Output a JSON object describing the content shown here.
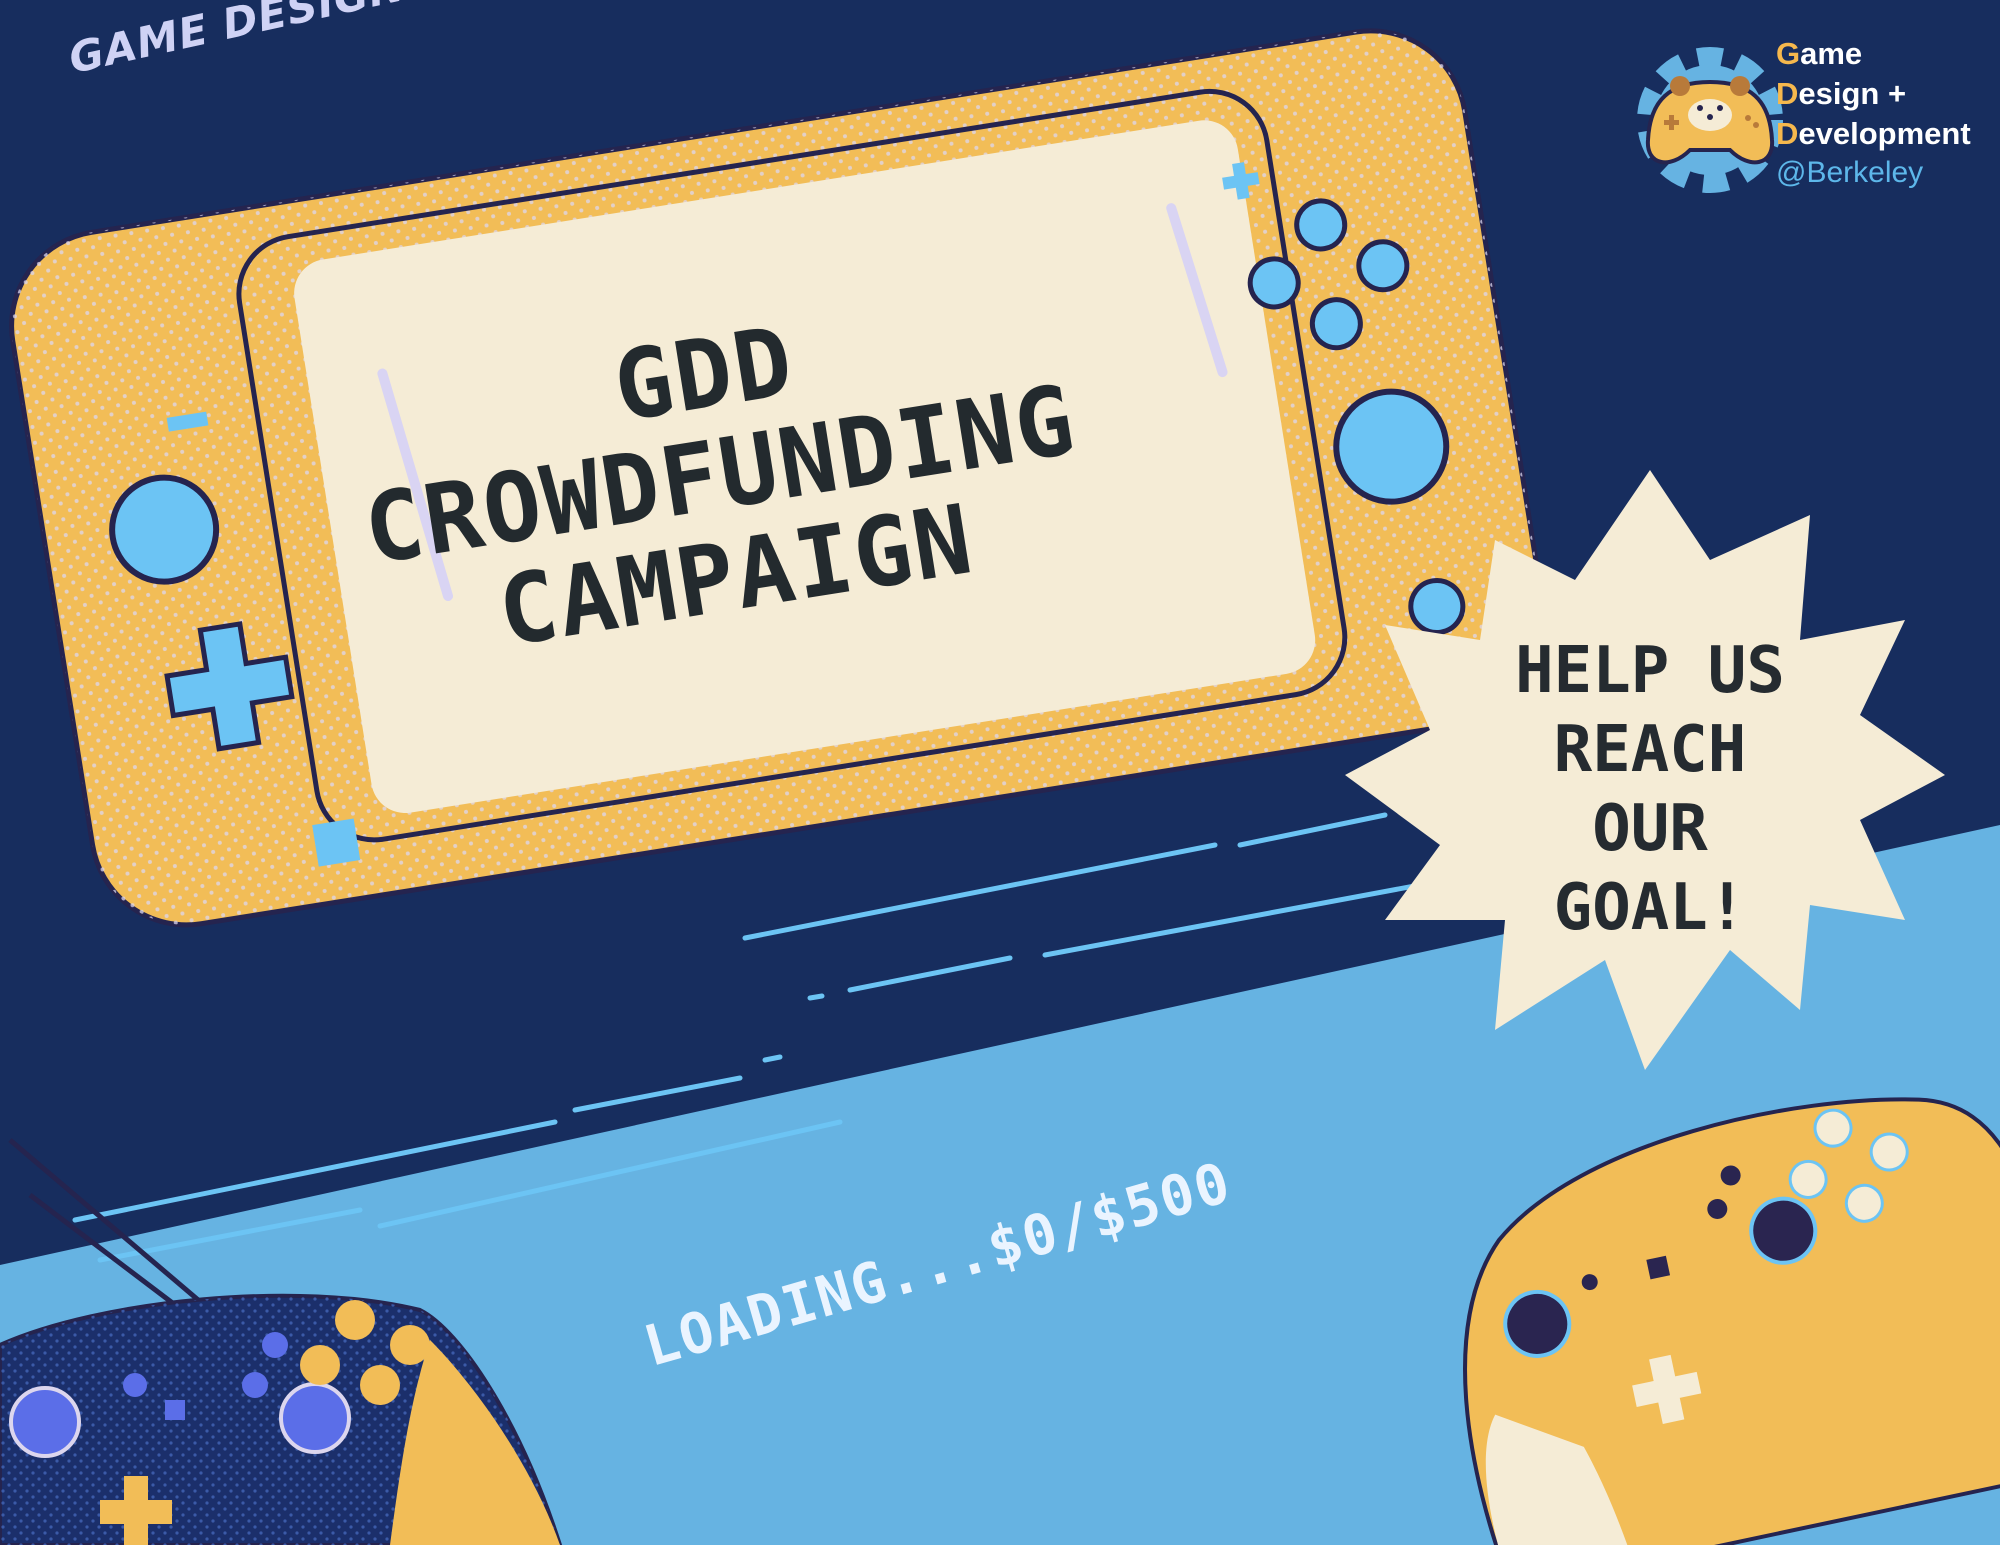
{
  "poster": {
    "club_banner": "GAME DESIGN & DEVELOPMENT AT BERKELEY",
    "title_lines": [
      "GDD",
      "CROWDFUNDING",
      "CAMPAIGN"
    ],
    "starburst_lines": [
      "HELP US",
      "REACH",
      "OUR",
      "GOAL!"
    ],
    "progress_text": "LOADING...$0/$500",
    "progress": {
      "raised": 0,
      "goal": 500,
      "currency": "$"
    }
  },
  "logo": {
    "line1_first": "G",
    "line1_rest": "ame",
    "line2_first": "D",
    "line2_rest": "esign +",
    "line3_first": "D",
    "line3_rest": "evelopment",
    "handle": "@Berkeley",
    "icon": "gear-bear-gamepad-icon"
  },
  "colors": {
    "background": "#172d5e",
    "band": "#66b3e2",
    "console_yellow": "#f2bd57",
    "screen_cream": "#f5ecd6",
    "button_blue": "#6cc4f4",
    "dark_outline": "#25244f"
  }
}
